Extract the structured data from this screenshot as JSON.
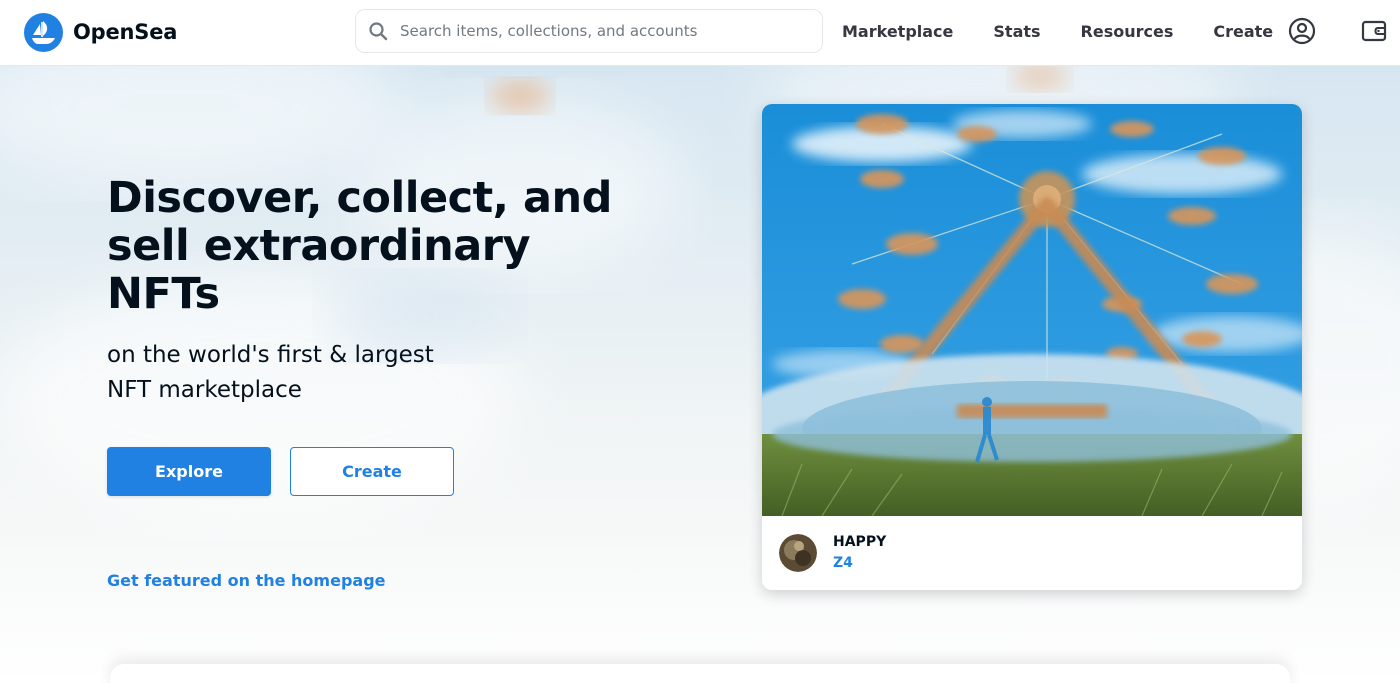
{
  "brand": {
    "name": "OpenSea",
    "logo_icon": "opensea-sailboat-icon",
    "color": "#2081e2"
  },
  "search": {
    "placeholder": "Search items, collections, and accounts",
    "value": "",
    "icon": "search-icon"
  },
  "nav": {
    "items": [
      {
        "label": "Marketplace"
      },
      {
        "label": "Stats"
      },
      {
        "label": "Resources"
      },
      {
        "label": "Create"
      }
    ],
    "profile_icon": "user-circle-icon",
    "wallet_icon": "wallet-icon"
  },
  "hero": {
    "headline": "Discover, collect, and sell extraordinary NFTs",
    "subheadline": "on the world's first & largest NFT marketplace",
    "explore_label": "Explore",
    "create_label": "Create",
    "featured_link": "Get featured on the homepage"
  },
  "featured_card": {
    "title": "HAPPY",
    "creator": "Z4",
    "image_icon": "ferris-wheel-artwork",
    "avatar_icon": "creator-avatar"
  },
  "colors": {
    "accent": "#2081e2",
    "text_primary": "#04111d",
    "text_secondary": "#353840",
    "placeholder": "#707a83",
    "border": "#e5e8eb"
  }
}
